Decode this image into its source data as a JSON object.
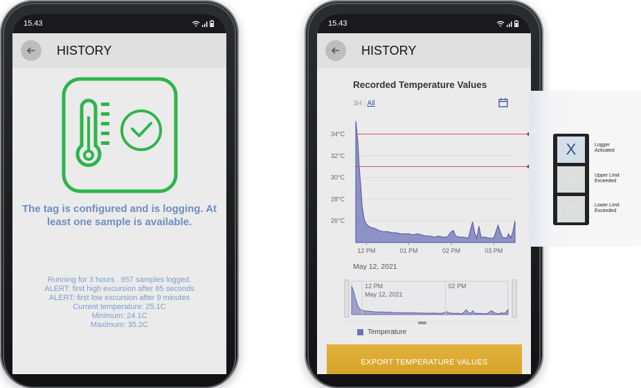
{
  "left_phone": {
    "time": "15.43",
    "title": "HISTORY",
    "status_message": "The tag is configured and is logging. At least one sample is available.",
    "details": [
      "Running for  3 hours .  957 samples logged.",
      "ALERT: first high excursion after  85 seconds",
      "ALERT: first low excursion after  9 minutes",
      "Current temperature:  25.1C",
      "Minimum:  24.1C",
      "Maximum:  35.2C"
    ]
  },
  "right_phone": {
    "time": "15.43",
    "title": "HISTORY",
    "chart_title": "Recorded Temperature Values",
    "range_3h": "3H",
    "range_all": "All",
    "date_label": "May 12, 2021",
    "mini_labels": [
      "12 PM",
      "May 12, 2021",
      "02 PM"
    ],
    "legend": "Temperature",
    "export_button": "EXPORT TEMPERATURE VALUES"
  },
  "chart_data": {
    "type": "area",
    "title": "Recorded Temperature Values",
    "ylabels": [
      "34°C",
      "32°C",
      "30°C",
      "28°C",
      "26°C"
    ],
    "xlabels": [
      "12 PM",
      "01 PM",
      "02 PM",
      "03 PM"
    ],
    "ylim": [
      24,
      35.5
    ],
    "xlim": [
      11.75,
      15.5
    ],
    "upper_limit": 34.0,
    "lower_limit": 31.0,
    "series": [
      {
        "name": "Temperature",
        "x": [
          11.75,
          11.8,
          11.83,
          11.87,
          11.9,
          11.95,
          12.0,
          12.05,
          12.1,
          12.2,
          12.3,
          12.4,
          12.5,
          12.6,
          12.7,
          12.8,
          12.9,
          13.0,
          13.1,
          13.2,
          13.3,
          13.4,
          13.5,
          13.6,
          13.7,
          13.8,
          13.9,
          14.0,
          14.05,
          14.1,
          14.2,
          14.3,
          14.4,
          14.5,
          14.55,
          14.6,
          14.65,
          14.7,
          14.8,
          14.9,
          15.0,
          15.1,
          15.2,
          15.3,
          15.35,
          15.4,
          15.45,
          15.5
        ],
        "values": [
          35.2,
          33.2,
          31.0,
          29.0,
          27.3,
          26.1,
          25.7,
          25.5,
          25.4,
          25.3,
          25.1,
          25.0,
          25.0,
          24.9,
          24.9,
          24.8,
          24.8,
          24.8,
          24.7,
          24.8,
          24.7,
          24.6,
          24.6,
          24.5,
          24.6,
          24.5,
          24.5,
          25.0,
          25.1,
          24.6,
          24.5,
          24.5,
          24.4,
          25.9,
          24.9,
          24.4,
          25.5,
          24.5,
          24.5,
          24.4,
          24.4,
          25.6,
          24.5,
          24.4,
          24.8,
          24.4,
          25.0,
          26.0
        ]
      }
    ],
    "color": "#6f73b8",
    "limit_color": "#d05050"
  },
  "label_card": {
    "symbol": "X",
    "rows": [
      {
        "lines": [
          "Logger",
          "Activated"
        ],
        "active": true
      },
      {
        "lines": [
          "Upper Limit",
          "Exceeded"
        ],
        "active": false
      },
      {
        "lines": [
          "Lower Limit",
          "Exceeded"
        ],
        "active": false
      }
    ]
  },
  "colors": {
    "icon_green": "#2db54b",
    "message_blue": "#6b8fc0",
    "export_gold": "#d9a82d"
  }
}
